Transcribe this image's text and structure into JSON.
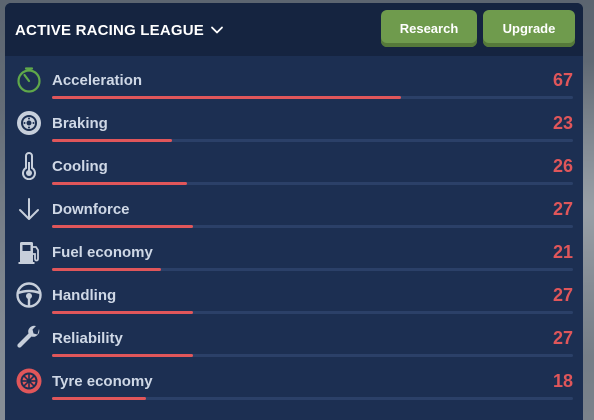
{
  "header": {
    "league_title": "ACTIVE RACING LEAGUE",
    "research_label": "Research",
    "upgrade_label": "Upgrade"
  },
  "colors": {
    "panel": "#1c2f52",
    "header": "#152440",
    "button_green": "#6f9b4d",
    "stat_red": "#e0565a",
    "accel_icon_green": "#5fa84a"
  },
  "stat_max": 100,
  "stats": [
    {
      "label": "Acceleration",
      "value": "67",
      "icon": "stopwatch-icon"
    },
    {
      "label": "Braking",
      "value": "23",
      "icon": "brake-disc-icon"
    },
    {
      "label": "Cooling",
      "value": "26",
      "icon": "thermometer-icon"
    },
    {
      "label": "Downforce",
      "value": "27",
      "icon": "down-arrow-icon"
    },
    {
      "label": "Fuel economy",
      "value": "21",
      "icon": "fuel-pump-icon"
    },
    {
      "label": "Handling",
      "value": "27",
      "icon": "steering-wheel-icon"
    },
    {
      "label": "Reliability",
      "value": "27",
      "icon": "wrench-icon"
    },
    {
      "label": "Tyre economy",
      "value": "18",
      "icon": "tyre-icon"
    }
  ]
}
